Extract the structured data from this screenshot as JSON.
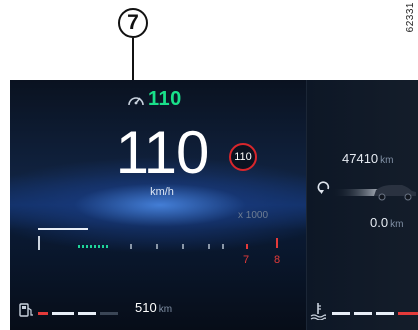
{
  "figure": {
    "callout_number": "7",
    "figure_id": "62331"
  },
  "cluster": {
    "set_speed": {
      "icon": "speed-limiter-icon",
      "value": "110",
      "color": "#19e08a"
    },
    "speed": {
      "value": "110",
      "unit": "km/h"
    },
    "speed_limit_sign": {
      "value": "110",
      "ring_color": "#d8262c"
    },
    "tachometer": {
      "multiplier": "x 1000",
      "marked_numbers": [
        "7",
        "8"
      ],
      "redline_color": "#e43a3a"
    },
    "fuel": {
      "icon": "fuel-pump-icon",
      "range_value": "510",
      "range_unit": "km",
      "low_color": "#e43a3a"
    },
    "odometer": {
      "value": "47410",
      "unit": "km"
    },
    "trip": {
      "icon": "trip-reset-icon",
      "value": "0.0",
      "unit": "km"
    },
    "coolant": {
      "icon": "coolant-temperature-icon"
    }
  }
}
